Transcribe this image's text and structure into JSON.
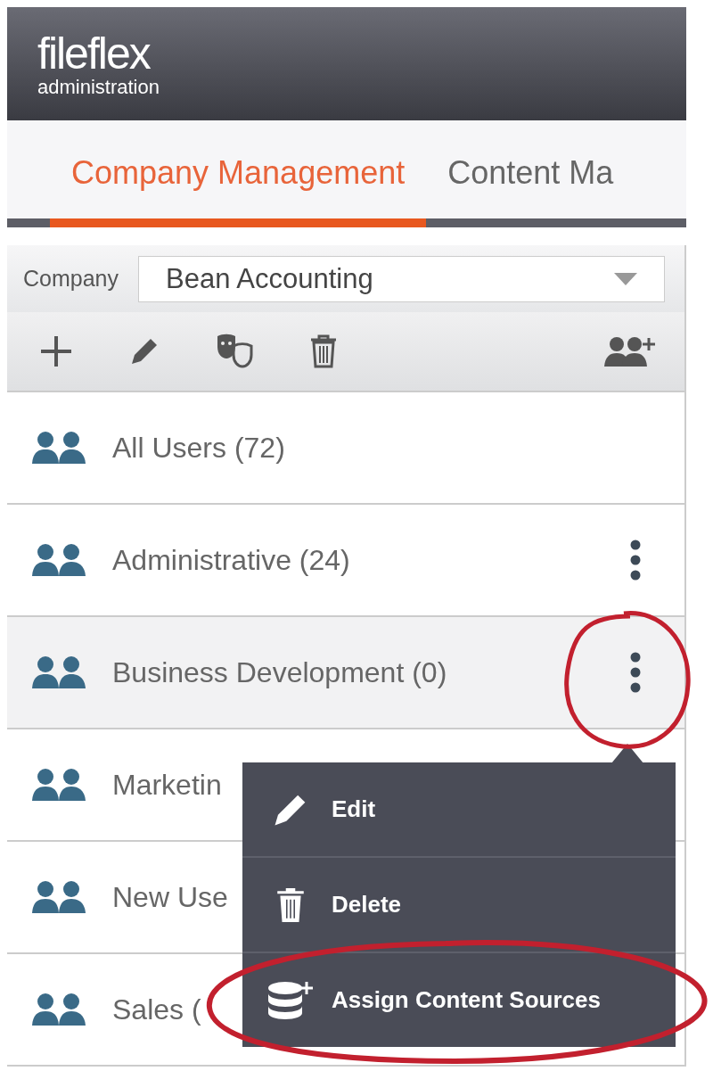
{
  "header": {
    "logo": "fileflex",
    "subtitle": "administration"
  },
  "tabs": [
    {
      "label": "Company Management",
      "selected": true
    },
    {
      "label": "Content Ma",
      "selected": false
    }
  ],
  "company": {
    "label": "Company",
    "value": "Bean Accounting"
  },
  "groups": [
    {
      "name": "All Users (72)",
      "selected": false,
      "has_menu": false
    },
    {
      "name": "Administrative (24)",
      "selected": false,
      "has_menu": true
    },
    {
      "name": "Business Development (0)",
      "selected": true,
      "has_menu": true
    },
    {
      "name": "Marketin",
      "selected": false,
      "has_menu": false
    },
    {
      "name": "New Use",
      "selected": false,
      "has_menu": false
    },
    {
      "name": "Sales (",
      "selected": false,
      "has_menu": false
    }
  ],
  "context_menu": {
    "items": [
      {
        "label": "Edit",
        "kind": "edit"
      },
      {
        "label": "Delete",
        "kind": "delete"
      },
      {
        "label": "Assign Content Sources",
        "kind": "assign"
      }
    ]
  }
}
